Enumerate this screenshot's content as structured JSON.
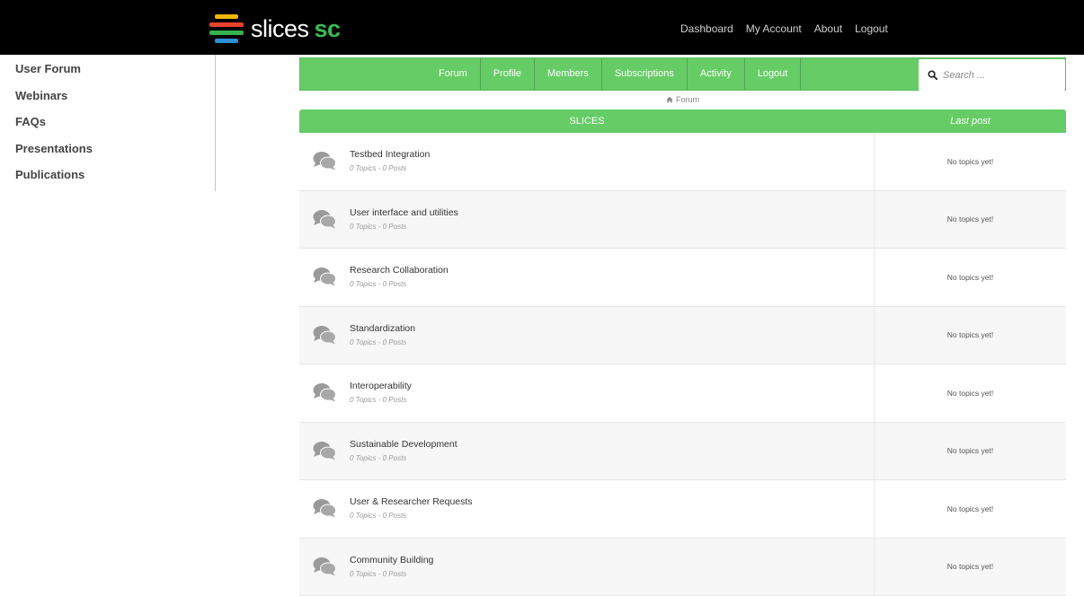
{
  "header": {
    "logo_text": "slices",
    "logo_suffix": "sc",
    "nav": [
      "Dashboard",
      "My Account",
      "About",
      "Logout"
    ]
  },
  "sidebar": {
    "items": [
      "User Forum",
      "Webinars",
      "FAQs",
      "Presentations",
      "Publications"
    ]
  },
  "forum_nav": {
    "links": [
      "Forum",
      "Profile",
      "Members",
      "Subscriptions",
      "Activity",
      "Logout"
    ],
    "search_placeholder": "Search ...",
    "search_icon": "search-icon"
  },
  "breadcrumb": {
    "icon": "home-icon",
    "label": "Forum"
  },
  "forum_table": {
    "header_title": "SLICES",
    "header_last_post": "Last post",
    "rows": [
      {
        "name": "Testbed Integration",
        "meta": "0 Topics - 0 Posts",
        "last_post": "No topics yet!"
      },
      {
        "name": "User interface and utilities",
        "meta": "0 Topics - 0 Posts",
        "last_post": "No topics yet!"
      },
      {
        "name": "Research Collaboration",
        "meta": "0 Topics - 0 Posts",
        "last_post": "No topics yet!"
      },
      {
        "name": "Standardization",
        "meta": "0 Topics - 0 Posts",
        "last_post": "No topics yet!"
      },
      {
        "name": "Interoperability",
        "meta": "0 Topics - 0 Posts",
        "last_post": "No topics yet!"
      },
      {
        "name": "Sustainable Development",
        "meta": "0 Topics - 0 Posts",
        "last_post": "No topics yet!"
      },
      {
        "name": "User & Researcher Requests",
        "meta": "0 Topics - 0 Posts",
        "last_post": "No topics yet!"
      },
      {
        "name": "Community Building",
        "meta": "0 Topics - 0 Posts",
        "last_post": "No topics yet!"
      }
    ]
  },
  "colors": {
    "accent_green": "#66cc66",
    "topbar": "#000000",
    "logo_sc": "#3cba54"
  }
}
